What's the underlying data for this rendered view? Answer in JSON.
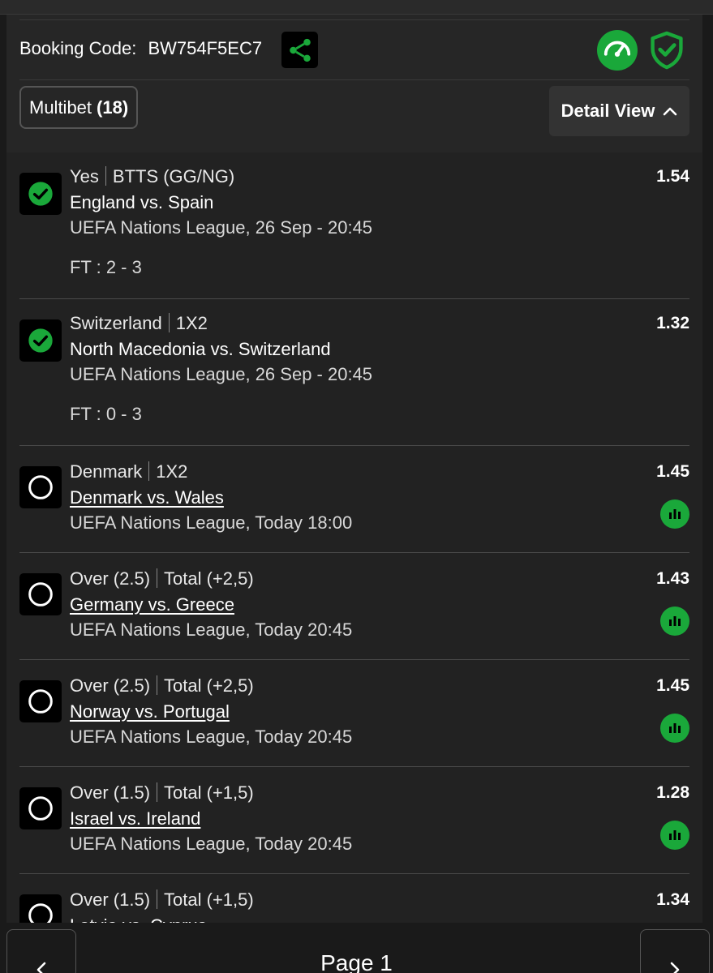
{
  "header": {
    "booking_label": "Booking Code:",
    "booking_code": "BW754F5EC7",
    "share_icon": "share-icon",
    "speed_icon": "speedometer-icon",
    "shield_icon": "shield-check-icon"
  },
  "multibet": {
    "label": "Multibet",
    "count": "(18)"
  },
  "detail_view": {
    "label": "Detail View",
    "icon": "chevron-up-icon"
  },
  "bets": [
    {
      "status": "won",
      "selection": "Yes",
      "market": "BTTS (GG/NG)",
      "match": "England vs. Spain",
      "league": "UEFA Nations League, 26 Sep - 20:45",
      "ft": "FT : 2 - 3",
      "odds": "1.54"
    },
    {
      "status": "won",
      "selection": "Switzerland",
      "market": "1X2",
      "match": "North Macedonia vs. Switzerland",
      "league": "UEFA Nations League, 26 Sep - 20:45",
      "ft": "FT : 0 - 3",
      "odds": "1.32"
    },
    {
      "status": "pending",
      "selection": "Denmark",
      "market": "1X2",
      "match": "Denmark vs. Wales",
      "league": "UEFA Nations League, Today 18:00",
      "odds": "1.45"
    },
    {
      "status": "pending",
      "selection": "Over (2.5)",
      "market": "Total (+2,5)",
      "match": "Germany vs. Greece",
      "league": "UEFA Nations League, Today 20:45",
      "odds": "1.43"
    },
    {
      "status": "pending",
      "selection": "Over (2.5)",
      "market": "Total (+2,5)",
      "match": "Norway vs. Portugal",
      "league": "UEFA Nations League, Today 20:45",
      "odds": "1.45"
    },
    {
      "status": "pending",
      "selection": "Over (1.5)",
      "market": "Total (+1,5)",
      "match": "Israel vs. Ireland",
      "league": "UEFA Nations League, Today 20:45",
      "odds": "1.28"
    },
    {
      "status": "pending",
      "selection": "Over (1.5)",
      "market": "Total (+1,5)",
      "match": "Latvia vs. Cyprus",
      "odds": "1.34"
    }
  ],
  "pager": {
    "label": "Page 1",
    "prev_icon": "chevron-left-icon",
    "next_icon": "chevron-right-icon"
  },
  "colors": {
    "accent_green": "#1aa83a",
    "background": "#222222"
  }
}
